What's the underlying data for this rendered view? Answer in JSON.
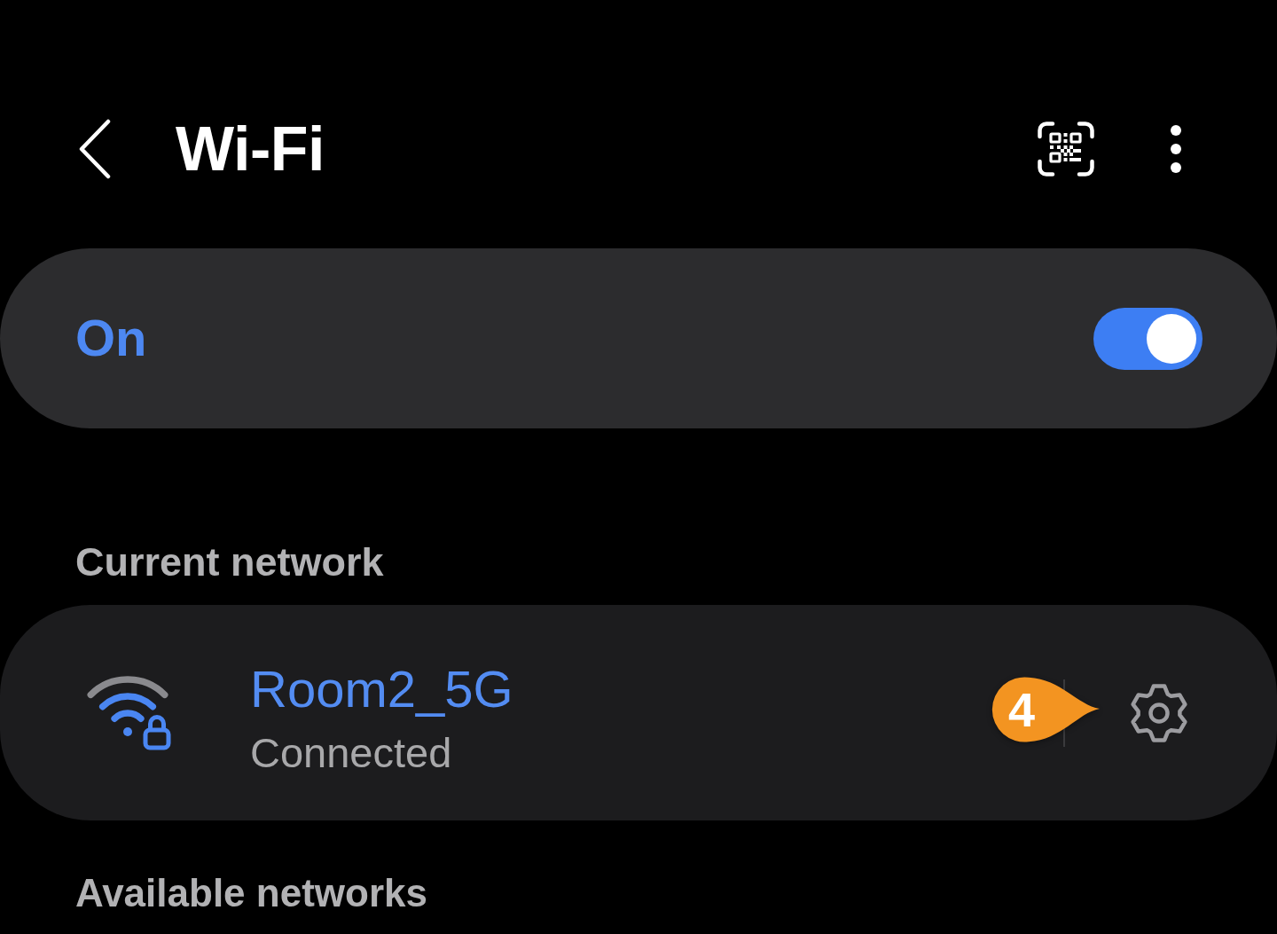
{
  "header": {
    "title": "Wi-Fi"
  },
  "wifi_toggle": {
    "label": "On",
    "on": true
  },
  "current_network": {
    "heading": "Current network",
    "network": {
      "name": "Room2_5G",
      "status": "Connected",
      "secured": true
    }
  },
  "callout": {
    "label": "4"
  },
  "available_networks": {
    "heading": "Available networks"
  }
}
